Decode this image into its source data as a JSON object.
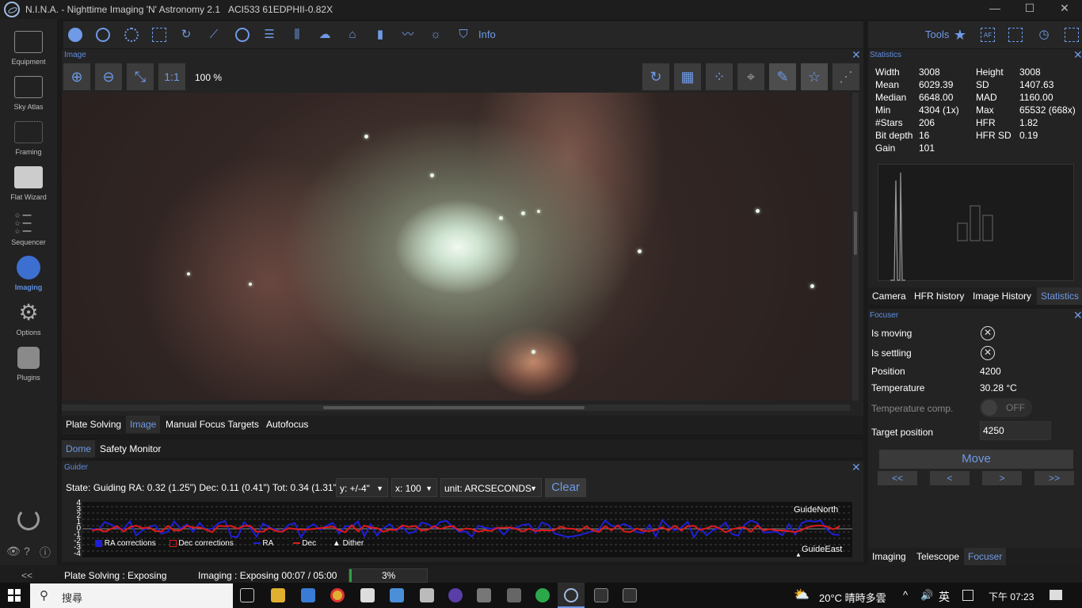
{
  "window": {
    "title": "N.I.N.A. - Nighttime Imaging 'N' Astronomy 2.1",
    "camera": "ACI533 61EDPHII-0.82X",
    "minimize": "—",
    "maximize": "☐",
    "close": "✕"
  },
  "nav": {
    "items": [
      "Equipment",
      "Sky Atlas",
      "Framing",
      "Flat Wizard",
      "Sequencer",
      "Imaging",
      "Options",
      "Plugins"
    ],
    "active": "Imaging"
  },
  "toolbar": {
    "info_label": "Info",
    "tools_label": "Tools",
    "af_label": "AF"
  },
  "image_panel": {
    "title": "Image",
    "zoom_label": "1:1",
    "zoom_value": "100 %"
  },
  "tabs_bottom": [
    "Plate Solving",
    "Image",
    "Manual Focus Targets",
    "Autofocus"
  ],
  "tabs_bottom_selected": "Image",
  "tabs_second": [
    "Dome",
    "Safety Monitor"
  ],
  "tabs_second_selected": "Dome",
  "guider": {
    "title": "Guider",
    "state": "State: Guiding  RA: 0.32 (1.25\")  Dec: 0.11 (0.41\")  Tot: 0.34 (1.31\")",
    "y_scale": "y: +/-4\"",
    "x_scale": "x: 100",
    "unit": "unit: ARCSECONDS",
    "clear": "Clear",
    "y_ticks": [
      "4",
      "3",
      "2",
      "1",
      "0",
      "-1",
      "-2",
      "-3",
      "-4"
    ],
    "guide_north": "GuideNorth",
    "guide_east": "GuideEast",
    "legend": [
      "RA corrections",
      "Dec corrections",
      "RA",
      "Dec",
      "Dither"
    ],
    "colors": {
      "ra": "#1f1fd6",
      "dec": "#e01b1b"
    }
  },
  "statistics": {
    "title": "Statistics",
    "rows": [
      [
        "Width",
        "3008",
        "Height",
        "3008"
      ],
      [
        "Mean",
        "6029.39",
        "SD",
        "1407.63"
      ],
      [
        "Median",
        "6648.00",
        "MAD",
        "1160.00"
      ],
      [
        "Min",
        "4304 (1x)",
        "Max",
        "65532 (668x)"
      ],
      [
        "#Stars",
        "206",
        "HFR",
        "1.82"
      ],
      [
        "Bit depth",
        "16",
        "HFR SD",
        "0.19"
      ],
      [
        "Gain",
        "101",
        "",
        ""
      ]
    ],
    "tabs": [
      "Camera",
      "HFR history",
      "Image History",
      "Statistics"
    ],
    "tabs_selected": "Statistics"
  },
  "focuser": {
    "title": "Focuser",
    "is_moving": "Is moving",
    "is_settling": "Is settling",
    "position_label": "Position",
    "position": "4200",
    "temperature_label": "Temperature",
    "temperature": "30.28 °C",
    "temp_comp_label": "Temperature comp.",
    "temp_comp": "OFF",
    "target_label": "Target position",
    "target": "4250",
    "move": "Move",
    "steps": [
      "<<",
      "<",
      ">",
      ">>"
    ],
    "tabs": [
      "Imaging",
      "Telescope",
      "Focuser"
    ],
    "tabs_selected": "Focuser"
  },
  "statusbar": {
    "left_toggle": "<<",
    "plate": "Plate Solving :   Exposing",
    "imaging": "Imaging :   Exposing 00:07 / 05:00",
    "progress_text": "3%",
    "progress": 0.03
  },
  "taskbar": {
    "search": "搜尋",
    "weather": "20°C  晴時多雲",
    "ime": "英",
    "time": "下午 07:23"
  }
}
